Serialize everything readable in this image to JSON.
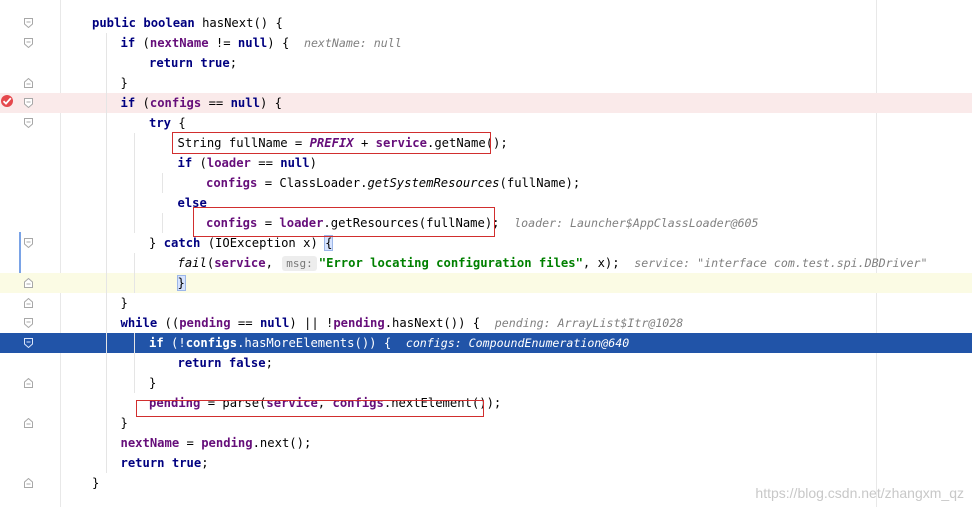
{
  "editor": {
    "lines": [
      {
        "tokens": [
          {
            "t": "public ",
            "c": "kw"
          },
          {
            "t": "boolean ",
            "c": "kw"
          },
          {
            "t": "hasNext() {"
          }
        ]
      },
      {
        "tokens": [
          {
            "t": "if ",
            "c": "kw"
          },
          {
            "t": "("
          },
          {
            "t": "nextName",
            "c": "fld"
          },
          {
            "t": " != "
          },
          {
            "t": "null",
            "c": "kw"
          },
          {
            "t": ") {  "
          },
          {
            "t": "nextName: null",
            "c": "hint"
          }
        ]
      },
      {
        "tokens": [
          {
            "t": "return ",
            "c": "kw"
          },
          {
            "t": "true",
            "c": "kw"
          },
          {
            "t": ";"
          }
        ]
      },
      {
        "tokens": [
          {
            "t": "}"
          }
        ]
      },
      {
        "tokens": [
          {
            "t": "if ",
            "c": "kw"
          },
          {
            "t": "("
          },
          {
            "t": "configs",
            "c": "fld"
          },
          {
            "t": " == "
          },
          {
            "t": "null",
            "c": "kw"
          },
          {
            "t": ") {"
          }
        ]
      },
      {
        "tokens": [
          {
            "t": "try ",
            "c": "kw"
          },
          {
            "t": "{"
          }
        ]
      },
      {
        "tokens": [
          {
            "t": "String fullName = "
          },
          {
            "t": "PREFIX",
            "c": "const"
          },
          {
            "t": " + "
          },
          {
            "t": "service",
            "c": "fld"
          },
          {
            "t": ".getName();"
          }
        ]
      },
      {
        "tokens": [
          {
            "t": "if ",
            "c": "kw"
          },
          {
            "t": "("
          },
          {
            "t": "loader",
            "c": "fld"
          },
          {
            "t": " == "
          },
          {
            "t": "null",
            "c": "kw"
          },
          {
            "t": ")"
          }
        ]
      },
      {
        "tokens": [
          {
            "t": "configs",
            "c": "fld"
          },
          {
            "t": " = ClassLoader."
          },
          {
            "t": "getSystemResources",
            "c": "static"
          },
          {
            "t": "(fullName);"
          }
        ]
      },
      {
        "tokens": [
          {
            "t": "else",
            "c": "kw"
          }
        ]
      },
      {
        "tokens": [
          {
            "t": "configs",
            "c": "fld"
          },
          {
            "t": " = "
          },
          {
            "t": "loader",
            "c": "fld"
          },
          {
            "t": ".getResources(fullName);  "
          },
          {
            "t": "loader: Launcher$AppClassLoader@605",
            "c": "hint"
          }
        ]
      },
      {
        "tokens": [
          {
            "t": "} "
          },
          {
            "t": "catch ",
            "c": "kw"
          },
          {
            "t": "(IOException x) "
          },
          {
            "t": "{",
            "c": "caretbox"
          }
        ]
      },
      {
        "tokens": [
          {
            "t": "fail",
            "c": "static"
          },
          {
            "t": "("
          },
          {
            "t": "service",
            "c": "fld"
          },
          {
            "t": ", "
          },
          {
            "t": "msg:",
            "c": "paramhint"
          },
          {
            "t": "\"Error locating configuration files\"",
            "c": "str"
          },
          {
            "t": ", x);  "
          },
          {
            "t": "service: \"interface com.test.spi.DBDriver\"",
            "c": "hint"
          }
        ]
      },
      {
        "tokens": [
          {
            "t": "}",
            "c": "caretbox"
          }
        ]
      },
      {
        "tokens": [
          {
            "t": "}"
          }
        ]
      },
      {
        "tokens": [
          {
            "t": "while ",
            "c": "kw"
          },
          {
            "t": "(("
          },
          {
            "t": "pending",
            "c": "fld"
          },
          {
            "t": " == "
          },
          {
            "t": "null",
            "c": "kw"
          },
          {
            "t": ") || !"
          },
          {
            "t": "pending",
            "c": "fld"
          },
          {
            "t": ".hasNext()) {  "
          },
          {
            "t": "pending: ArrayList$Itr@1028",
            "c": "hint"
          }
        ]
      },
      {
        "tokens": [
          {
            "t": "if ",
            "c": "kw"
          },
          {
            "t": "(!"
          },
          {
            "t": "configs",
            "c": "fld"
          },
          {
            "t": ".hasMoreElements()) {  "
          },
          {
            "t": "configs: CompoundEnumeration@640",
            "c": "hint"
          }
        ]
      },
      {
        "tokens": [
          {
            "t": "return ",
            "c": "kw"
          },
          {
            "t": "false",
            "c": "kw"
          },
          {
            "t": ";"
          }
        ]
      },
      {
        "tokens": [
          {
            "t": "}"
          }
        ]
      },
      {
        "tokens": [
          {
            "t": "pending",
            "c": "fld"
          },
          {
            "t": " = parse("
          },
          {
            "t": "service",
            "c": "fld"
          },
          {
            "t": ", "
          },
          {
            "t": "configs",
            "c": "fld"
          },
          {
            "t": ".nextElement());"
          }
        ]
      },
      {
        "tokens": [
          {
            "t": "}"
          }
        ]
      },
      {
        "tokens": [
          {
            "t": "nextName",
            "c": "fld"
          },
          {
            "t": " = "
          },
          {
            "t": "pending",
            "c": "fld"
          },
          {
            "t": ".next();"
          }
        ]
      },
      {
        "tokens": [
          {
            "t": "return ",
            "c": "kw"
          },
          {
            "t": "true",
            "c": "kw"
          },
          {
            "t": ";"
          }
        ]
      },
      {
        "tokens": [
          {
            "t": "}"
          }
        ]
      }
    ]
  },
  "watermark": "https://blog.csdn.net/zhangxm_qz",
  "colors": {
    "execution_line": "#2154a8",
    "breakpoint_line": "#faeaea",
    "highlight_box": "#d12e2e"
  }
}
